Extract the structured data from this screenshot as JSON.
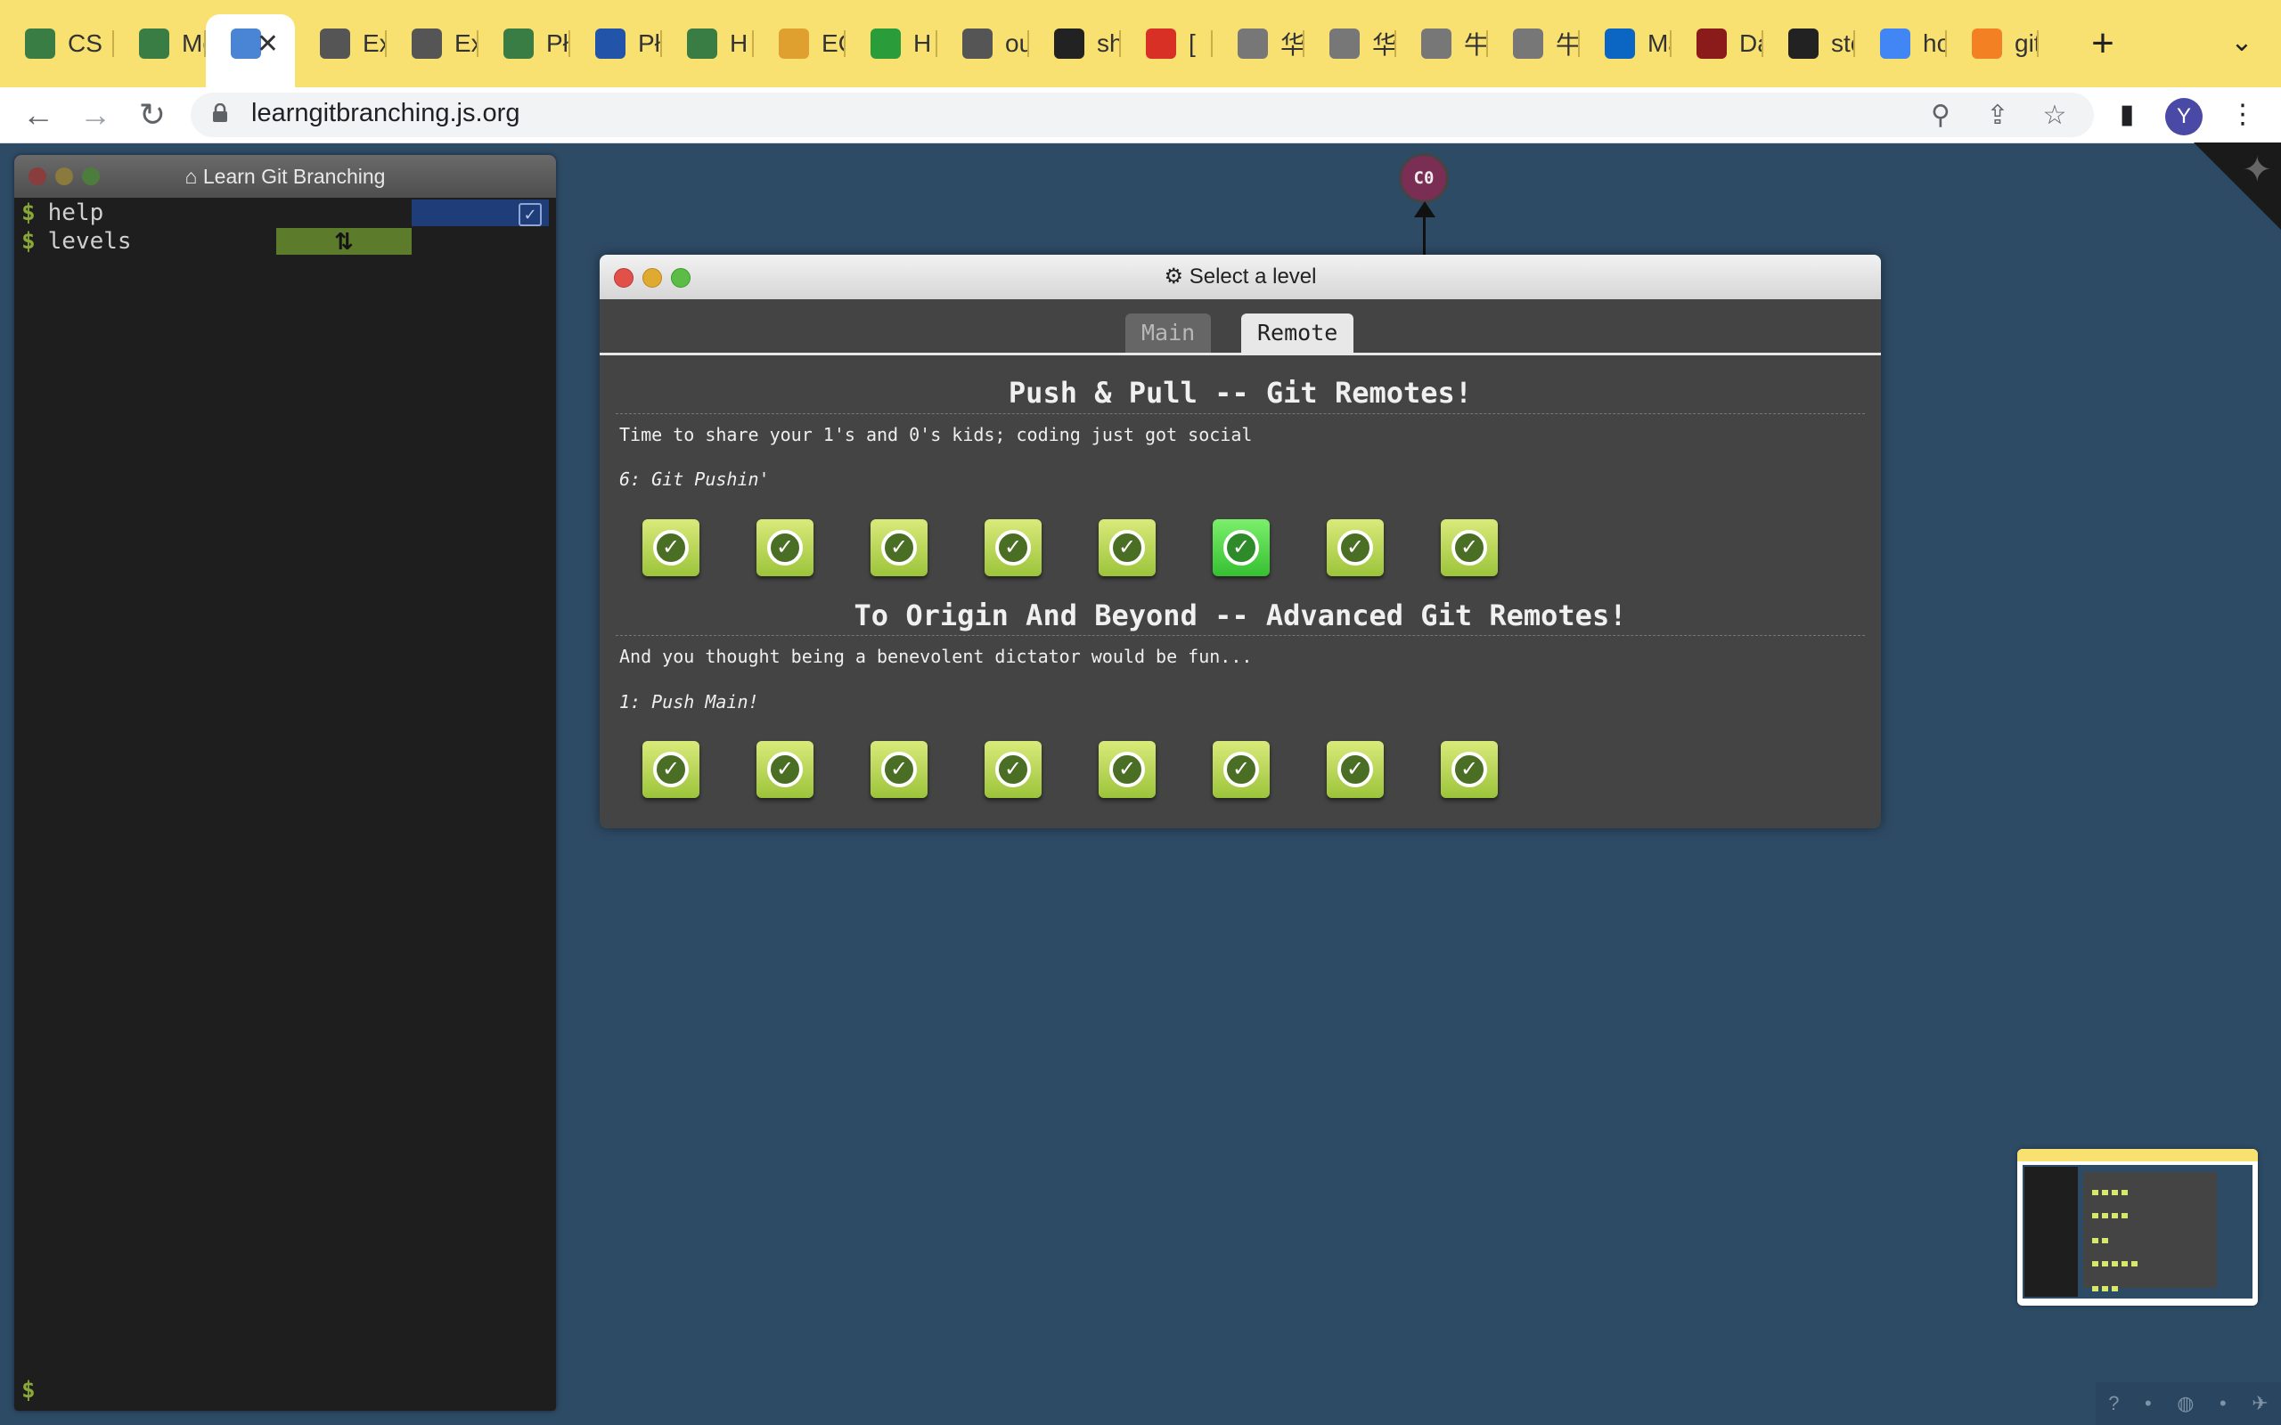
{
  "browser": {
    "tabs": [
      {
        "label": "CS",
        "icon": "castle-icon",
        "color": "#3a7d44"
      },
      {
        "label": "Mc",
        "icon": "castle-icon",
        "color": "#3a7d44"
      },
      {
        "label": "",
        "icon": "git-branch-icon",
        "color": "#4a84d4",
        "active": true
      },
      {
        "label": "Ex",
        "icon": "globe-icon",
        "color": "#555"
      },
      {
        "label": "Ex",
        "icon": "globe-icon",
        "color": "#555"
      },
      {
        "label": "Pł",
        "icon": "castle-icon",
        "color": "#3a7d44"
      },
      {
        "label": "Pł",
        "icon": "u-icon",
        "color": "#2255aa"
      },
      {
        "label": "H",
        "icon": "castle-icon",
        "color": "#3a7d44"
      },
      {
        "label": "EC",
        "icon": "box-icon",
        "color": "#e0a030"
      },
      {
        "label": "H",
        "icon": "w3-icon",
        "color": "#2a9d3a"
      },
      {
        "label": "ou",
        "icon": "globe-icon",
        "color": "#555"
      },
      {
        "label": "sh",
        "icon": "github-icon",
        "color": "#222"
      },
      {
        "label": "[",
        "icon": "gmail-icon",
        "color": "#d93025"
      },
      {
        "label": "华",
        "icon": "page-icon",
        "color": "#777"
      },
      {
        "label": "华",
        "icon": "page-icon",
        "color": "#777"
      },
      {
        "label": "牛",
        "icon": "page-icon",
        "color": "#777"
      },
      {
        "label": "牛",
        "icon": "page-icon",
        "color": "#777"
      },
      {
        "label": "Mε",
        "icon": "outlook-icon",
        "color": "#0a66c2"
      },
      {
        "label": "Da",
        "icon": "crest-icon",
        "color": "#8b1a1a"
      },
      {
        "label": "stc",
        "icon": "g-circle-icon",
        "color": "#222"
      },
      {
        "label": "ho",
        "icon": "google-icon",
        "color": "#4285f4"
      },
      {
        "label": "git",
        "icon": "stackoverflow-icon",
        "color": "#f48024"
      }
    ],
    "active_tab_close": "✕",
    "new_tab": "+",
    "tab_menu": "⌄",
    "url": "learngitbranching.js.org",
    "profile_initial": "Y"
  },
  "terminal": {
    "title": "Learn Git Branching",
    "lines": [
      "help",
      "levels"
    ],
    "prompt": "$",
    "toggle_glyph": "⇅"
  },
  "graph": {
    "node_label": "C0"
  },
  "modal": {
    "title": "Select a level",
    "tabs": {
      "main": "Main",
      "remote": "Remote"
    },
    "sections": [
      {
        "title": "Push & Pull -- Git Remotes!",
        "description": "Time to share your 1's and 0's kids; coding just got social",
        "current_level": "6: Git Pushin'",
        "levels_completed": 8,
        "selected_index": 5
      },
      {
        "title": "To Origin And Beyond -- Advanced Git Remotes!",
        "description": "And you thought being a benevolent dictator would be fun...",
        "current_level": "1: Push Main!",
        "levels_completed": 8,
        "selected_index": -1
      }
    ]
  },
  "colors": {
    "background": "#2e4b66",
    "tab_strip": "#f8e071",
    "level_complete": "#9cc43b",
    "level_selected": "#36c032"
  }
}
